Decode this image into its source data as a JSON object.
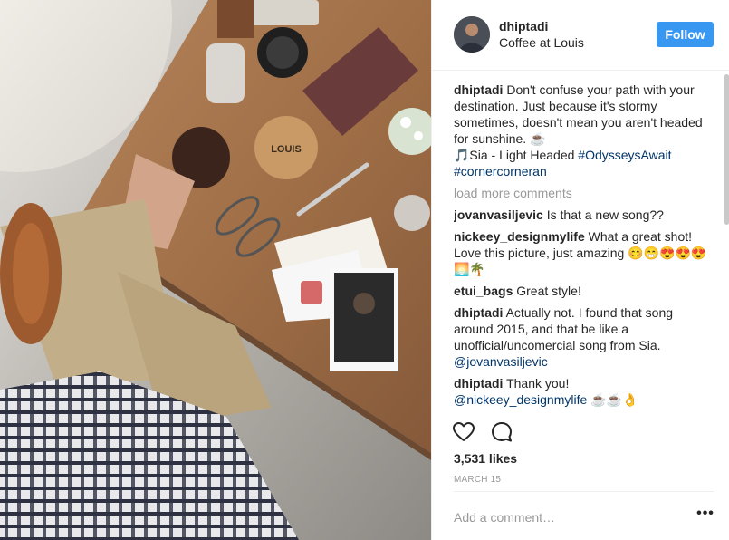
{
  "post": {
    "author": "dhiptadi",
    "location": "Coffee at Louis",
    "follow_label": "Follow",
    "photo_label": "LOUIS",
    "caption": {
      "user": "dhiptadi",
      "text": "Don't confuse your path with your destination. Just because it's stormy sometimes, doesn't mean you aren't headed for sunshine. ☕",
      "music": "🎵Sia - Light Headed ",
      "tag1": "#OdysseysAwait",
      "tag2": "#cornercorneran"
    },
    "load_more": "load more comments",
    "comments": [
      {
        "user": "jovanvasiljevic",
        "text": "Is that a new song??"
      },
      {
        "user": "nickeey_designmylife",
        "text": "What a great shot! Love this picture, just amazing 😊😁😍😍😍 🌅🌴"
      },
      {
        "user": "etui_bags",
        "text": "Great style!"
      },
      {
        "user": "dhiptadi",
        "text": "Actually not. I found that song around 2015, and that be like a unofficial/uncomercial song from Sia.",
        "mention": "@jovanvasiljevic"
      },
      {
        "user": "dhiptadi",
        "text": "Thank you!",
        "mention": "@nickeey_designmylife",
        "after": " ☕☕👌"
      }
    ],
    "likes": "3,531 likes",
    "date": "MARCH 15",
    "add_comment_placeholder": "Add a comment…",
    "more_label": "•••",
    "colors": {
      "follow": "#3897f0",
      "link": "#003569",
      "muted": "#999999"
    },
    "icons": [
      "heart-icon",
      "comment-icon",
      "more-options-icon"
    ]
  }
}
